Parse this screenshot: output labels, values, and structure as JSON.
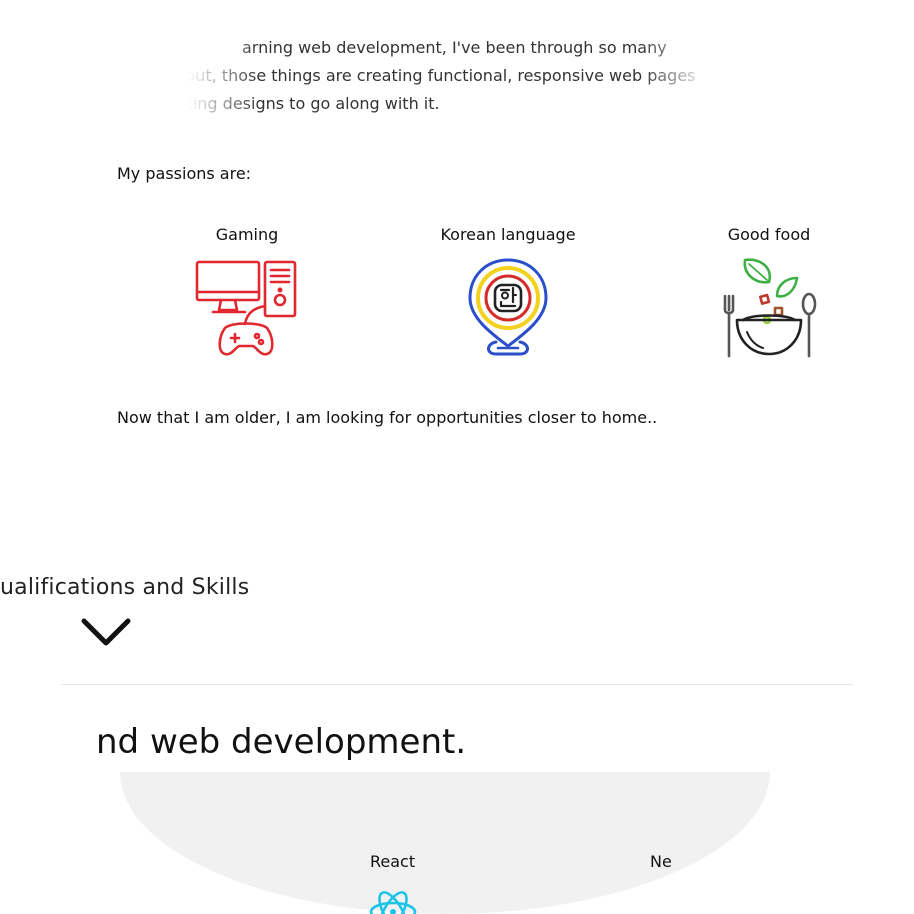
{
  "intro": {
    "line1": "arning web development, I've been through so many",
    "line2": "s out, those things are creating functional, responsive web pages",
    "line3": "ooking designs to go along with it."
  },
  "passions": {
    "title": "My passions are:",
    "items": [
      {
        "label": "Gaming",
        "icon": "gaming-pc-controller-icon"
      },
      {
        "label": "Korean language",
        "icon": "korean-hangul-map-pin-icon"
      },
      {
        "label": "Good food",
        "icon": "salad-bowl-icon"
      }
    ]
  },
  "older_text": "Now that I am older, I am looking for opportunities closer to home..",
  "qualifications": {
    "title_visible": "ualifications and Skills",
    "chevron_icon": "chevron-down-icon"
  },
  "headline": "nd web development.",
  "skills": {
    "react_label": "React",
    "node_label": "Ne",
    "react_icon": "react-icon"
  },
  "colors": {
    "gaming_red": "#e0282e",
    "korean_yellow": "#f2d21c",
    "korean_blue": "#2b4fc9",
    "korean_red": "#d62b2b",
    "food_green": "#3cb043",
    "food_gray": "#555555",
    "react_cyan": "#1ec3e8",
    "blob_gray": "#f1f1f1"
  }
}
